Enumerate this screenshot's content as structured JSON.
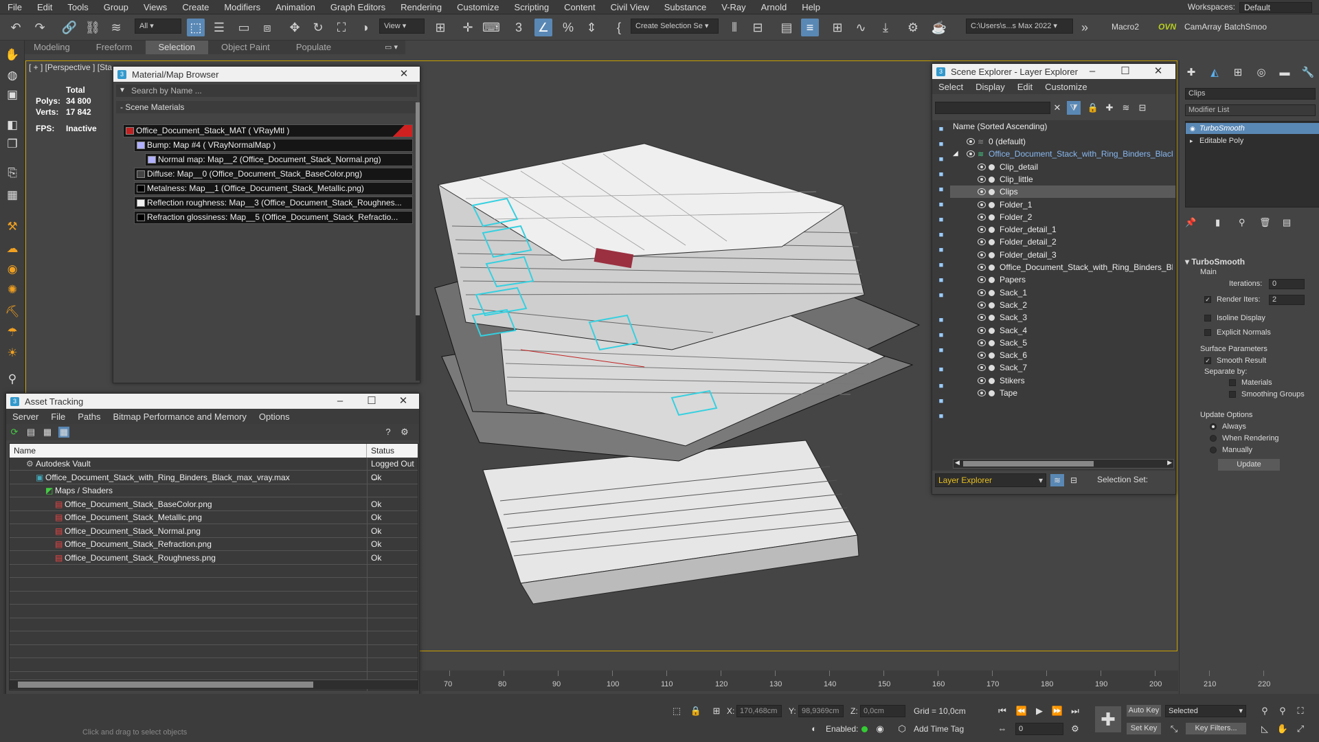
{
  "menubar": {
    "items": [
      "File",
      "Edit",
      "Tools",
      "Group",
      "Views",
      "Create",
      "Modifiers",
      "Animation",
      "Graph Editors",
      "Rendering",
      "Customize",
      "Scripting",
      "Content",
      "Civil View",
      "Substance",
      "V-Ray",
      "Arnold",
      "Help"
    ],
    "workspaces_label": "Workspaces:",
    "workspaces_value": "Default"
  },
  "toolbar": {
    "filter_value": "All",
    "view_value": "View",
    "create_selection_label": "Create Selection Se",
    "path_value": "C:\\Users\\s...s Max 2022",
    "macro2": "Macro2",
    "ovn": "OVN",
    "camarray": "CamArray",
    "batchsmoo": "BatchSmoo"
  },
  "ribbon": {
    "tabs": [
      "Modeling",
      "Freeform",
      "Selection",
      "Object Paint",
      "Populate"
    ],
    "active": "Selection"
  },
  "viewport": {
    "label": "[ + ] [Perspective ] [Sta",
    "stats": {
      "total_label": "Total",
      "polys_label": "Polys:",
      "polys_value": "34 800",
      "verts_label": "Verts:",
      "verts_value": "17 842",
      "fps_label": "FPS:",
      "fps_value": "Inactive"
    }
  },
  "material_browser": {
    "title": "Material/Map Browser",
    "search_placeholder": "Search by Name ...",
    "section": "- Scene Materials",
    "rows": [
      {
        "label": "Office_Document_Stack_MAT  ( VRayMtl )",
        "swatch": "#c02020",
        "indent": 0
      },
      {
        "label": "Bump: Map #4  ( VRayNormalMap )",
        "swatch": "#b0b0ff",
        "indent": 1
      },
      {
        "label": "Normal map: Map__2 (Office_Document_Stack_Normal.png)",
        "swatch": "#b0b0ff",
        "indent": 2
      },
      {
        "label": "Diffuse: Map__0 (Office_Document_Stack_BaseColor.png)",
        "swatch": "#444444",
        "indent": 1
      },
      {
        "label": "Metalness: Map__1 (Office_Document_Stack_Metallic.png)",
        "swatch": "#000000",
        "indent": 1
      },
      {
        "label": "Reflection roughness: Map__3 (Office_Document_Stack_Roughnes...",
        "swatch": "#f0f0f0",
        "indent": 1
      },
      {
        "label": "Refraction glossiness: Map__5 (Office_Document_Stack_Refractio...",
        "swatch": "#000000",
        "indent": 1
      }
    ]
  },
  "asset_tracking": {
    "title": "Asset Tracking",
    "menu": [
      "Server",
      "File",
      "Paths",
      "Bitmap Performance and Memory",
      "Options"
    ],
    "col_name": "Name",
    "col_status": "Status",
    "rows": [
      {
        "name": "Autodesk Vault",
        "status": "Logged Out ...",
        "indent": 1,
        "icon": "vault-icon"
      },
      {
        "name": "Office_Document_Stack_with_Ring_Binders_Black_max_vray.max",
        "status": "Ok",
        "indent": 2,
        "icon": "max-file-icon"
      },
      {
        "name": "Maps / Shaders",
        "status": "",
        "indent": 3,
        "icon": "maps-folder-icon"
      },
      {
        "name": "Office_Document_Stack_BaseColor.png",
        "status": "Ok",
        "indent": 4,
        "icon": "png-icon"
      },
      {
        "name": "Office_Document_Stack_Metallic.png",
        "status": "Ok",
        "indent": 4,
        "icon": "png-icon"
      },
      {
        "name": "Office_Document_Stack_Normal.png",
        "status": "Ok",
        "indent": 4,
        "icon": "png-icon"
      },
      {
        "name": "Office_Document_Stack_Refraction.png",
        "status": "Ok",
        "indent": 4,
        "icon": "png-icon"
      },
      {
        "name": "Office_Document_Stack_Roughness.png",
        "status": "Ok",
        "indent": 4,
        "icon": "png-icon"
      }
    ]
  },
  "scene_explorer": {
    "title": "Scene Explorer - Layer Explorer",
    "menu": [
      "Select",
      "Display",
      "Edit",
      "Customize"
    ],
    "header": "Name (Sorted Ascending)",
    "rows": [
      {
        "label": "0 (default)",
        "level": 0,
        "eye": true,
        "dot": false,
        "sel": false,
        "highlight": false
      },
      {
        "label": "Office_Document_Stack_with_Ring_Binders_Black",
        "level": 0,
        "eye": true,
        "dot": false,
        "sel": false,
        "highlight": true
      },
      {
        "label": "Clip_detail",
        "level": 1,
        "eye": true,
        "dot": true,
        "sel": false,
        "highlight": false
      },
      {
        "label": "Clip_little",
        "level": 1,
        "eye": true,
        "dot": true,
        "sel": false,
        "highlight": false
      },
      {
        "label": "Clips",
        "level": 1,
        "eye": true,
        "dot": true,
        "sel": true,
        "highlight": false
      },
      {
        "label": "Folder_1",
        "level": 1,
        "eye": true,
        "dot": true,
        "sel": false,
        "highlight": false
      },
      {
        "label": "Folder_2",
        "level": 1,
        "eye": true,
        "dot": true,
        "sel": false,
        "highlight": false
      },
      {
        "label": "Folder_detail_1",
        "level": 1,
        "eye": true,
        "dot": true,
        "sel": false,
        "highlight": false
      },
      {
        "label": "Folder_detail_2",
        "level": 1,
        "eye": true,
        "dot": true,
        "sel": false,
        "highlight": false
      },
      {
        "label": "Folder_detail_3",
        "level": 1,
        "eye": true,
        "dot": true,
        "sel": false,
        "highlight": false
      },
      {
        "label": "Office_Document_Stack_with_Ring_Binders_Blac",
        "level": 1,
        "eye": true,
        "dot": true,
        "sel": false,
        "highlight": false
      },
      {
        "label": "Papers",
        "level": 1,
        "eye": true,
        "dot": true,
        "sel": false,
        "highlight": false
      },
      {
        "label": "Sack_1",
        "level": 1,
        "eye": true,
        "dot": true,
        "sel": false,
        "highlight": false
      },
      {
        "label": "Sack_2",
        "level": 1,
        "eye": true,
        "dot": true,
        "sel": false,
        "highlight": false
      },
      {
        "label": "Sack_3",
        "level": 1,
        "eye": true,
        "dot": true,
        "sel": false,
        "highlight": false
      },
      {
        "label": "Sack_4",
        "level": 1,
        "eye": true,
        "dot": true,
        "sel": false,
        "highlight": false
      },
      {
        "label": "Sack_5",
        "level": 1,
        "eye": true,
        "dot": true,
        "sel": false,
        "highlight": false
      },
      {
        "label": "Sack_6",
        "level": 1,
        "eye": true,
        "dot": true,
        "sel": false,
        "highlight": false
      },
      {
        "label": "Sack_7",
        "level": 1,
        "eye": true,
        "dot": true,
        "sel": false,
        "highlight": false
      },
      {
        "label": "Stikers",
        "level": 1,
        "eye": true,
        "dot": true,
        "sel": false,
        "highlight": false
      },
      {
        "label": "Tape",
        "level": 1,
        "eye": true,
        "dot": true,
        "sel": false,
        "highlight": false
      }
    ],
    "footer_explorer": "Layer Explorer",
    "footer_selset": "Selection Set:"
  },
  "command_panel": {
    "name_field": "Clips",
    "modifier_list": "Modifier List",
    "stack": [
      {
        "label": "TurboSmooth",
        "active": true
      },
      {
        "label": "Editable Poly",
        "active": false
      }
    ],
    "rollout": "TurboSmooth",
    "main": "Main",
    "iterations_label": "Iterations:",
    "iterations_value": "0",
    "render_iters_label": "Render Iters:",
    "render_iters_value": "2",
    "isoline": "Isoline Display",
    "explicit": "Explicit Normals",
    "surface": "Surface Parameters",
    "smooth_result": "Smooth Result",
    "separate_by": "Separate by:",
    "materials": "Materials",
    "smoothing_groups": "Smoothing Groups",
    "update_options": "Update Options",
    "always": "Always",
    "when_rendering": "When Rendering",
    "manually": "Manually",
    "update_btn": "Update"
  },
  "timeline": {
    "ticks": [
      "70",
      "80",
      "90",
      "100",
      "110",
      "120",
      "130",
      "140",
      "150",
      "160",
      "170",
      "180",
      "190",
      "200",
      "210",
      "220"
    ]
  },
  "status": {
    "x_label": "X:",
    "x_value": "170,468cm",
    "y_label": "Y:",
    "y_value": "98,9369cm",
    "z_label": "Z:",
    "z_value": "0,0cm",
    "grid": "Grid = 10,0cm",
    "enabled": "Enabled:",
    "add_time_tag": "Add Time Tag",
    "auto_key": "Auto Key",
    "set_key": "Set Key",
    "selected": "Selected",
    "key_filters": "Key Filters...",
    "frame": "0",
    "prompt": "Click and drag to select objects"
  }
}
